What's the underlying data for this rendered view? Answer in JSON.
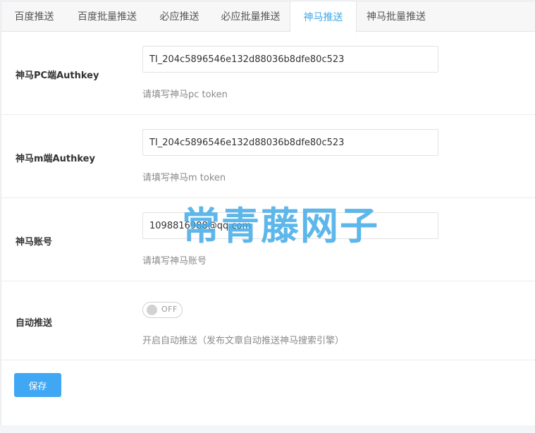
{
  "tabs": [
    {
      "label": "百度推送",
      "active": false
    },
    {
      "label": "百度批量推送",
      "active": false
    },
    {
      "label": "必应推送",
      "active": false
    },
    {
      "label": "必应批量推送",
      "active": false
    },
    {
      "label": "神马推送",
      "active": true
    },
    {
      "label": "神马批量推送",
      "active": false
    }
  ],
  "form": {
    "pc_authkey": {
      "label": "神马PC端Authkey",
      "value": "TI_204c5896546e132d88036b8dfe80c523",
      "help": "请填写神马pc token"
    },
    "m_authkey": {
      "label": "神马m端Authkey",
      "value": "TI_204c5896546e132d88036b8dfe80c523",
      "help": "请填写神马m token"
    },
    "account": {
      "label": "神马账号",
      "value": "1098816988@qq.com",
      "help": "请填写神马账号"
    },
    "auto_push": {
      "label": "自动推送",
      "state": "OFF",
      "help": "开启自动推送（发布文章自动推送神马搜索引擎）"
    }
  },
  "save_label": "保存",
  "watermark": "常青藤网子",
  "colors": {
    "accent": "#3fa7f4",
    "active_tab": "#3fa7e9",
    "watermark": "#42aae8"
  }
}
